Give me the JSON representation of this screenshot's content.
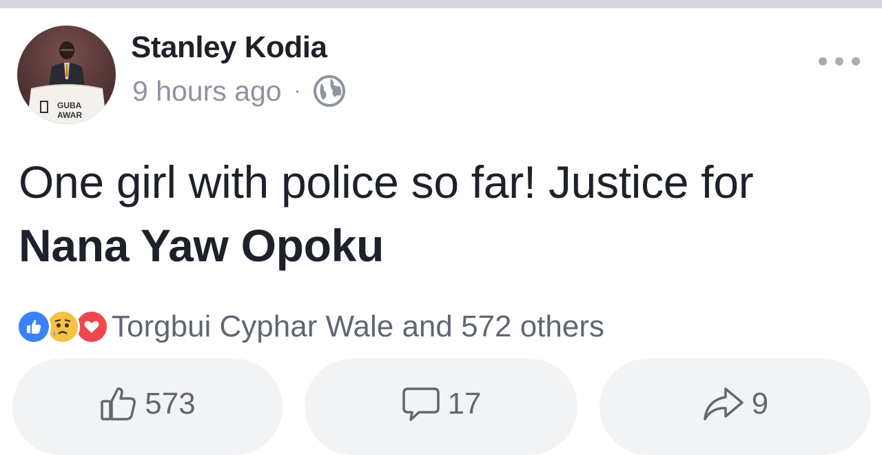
{
  "post": {
    "author": "Stanley Kodia",
    "timestamp": "9 hours ago",
    "separator": "·",
    "privacy_icon": "globe-icon",
    "avatar_caption_line1": "GUBA",
    "avatar_caption_line2": "AWAR",
    "text_prefix": "One girl with police so far! Justice for ",
    "mention": "Nana Yaw Opoku"
  },
  "reactions": {
    "icons": [
      "like-icon",
      "sad-icon",
      "love-icon"
    ],
    "summary": "Torgbui Cyphar Wale and 572 others"
  },
  "actions": {
    "like_count": "573",
    "comment_count": "17",
    "share_count": "9"
  },
  "colors": {
    "like_blue": "#3b82f6",
    "love_red": "#f0474e",
    "sad_yellow": "#f6c244",
    "muted_text": "#8d949e",
    "action_bg": "#f2f3f5"
  }
}
